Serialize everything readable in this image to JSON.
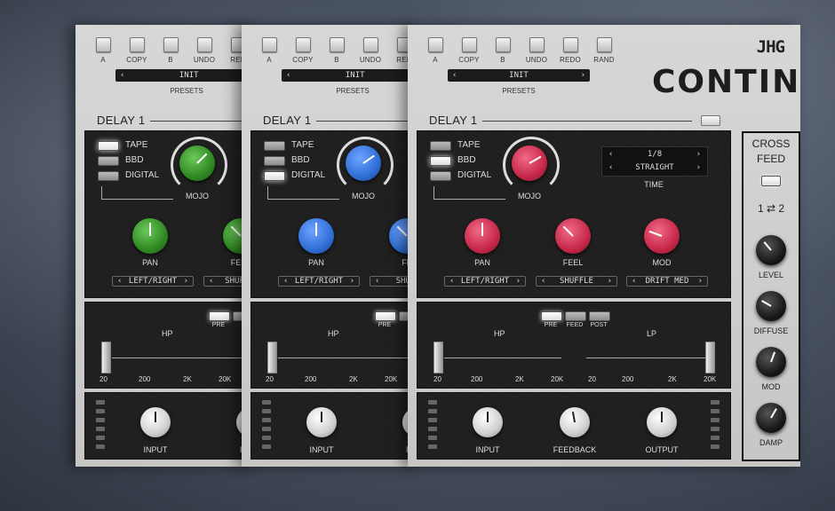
{
  "top_buttons": [
    "A",
    "COPY",
    "B",
    "UNDO",
    "REDO",
    "RAND"
  ],
  "top_buttons_clipped": "REDO",
  "top_buttons_clipped_short": "RED",
  "preset": {
    "value": "INIT",
    "label": "PRESETS",
    "prev": "‹",
    "next": "›"
  },
  "delay_title": "DELAY 1",
  "types": [
    "TAPE",
    "BBD",
    "DIGITAL"
  ],
  "brand": "CONTIN",
  "logo": "JHG",
  "labels": {
    "mojo": "MOJO",
    "pan": "PAN",
    "feel": "FEEL",
    "mod": "MOD",
    "time": "TIME",
    "input": "INPUT",
    "feedback": "FEEDBACK",
    "output": "OUTPUT",
    "hp": "HP",
    "lp": "LP",
    "pre": "PRE",
    "feed": "FEED",
    "post": "POST",
    "feel_clipped": "FE",
    "feed_clipped": "FEED"
  },
  "selectors": {
    "pan": "LEFT/RIGHT",
    "feel": "SHUFFLE",
    "feel_clipped": "SHUFF",
    "feel_clipped2": "SHU",
    "mod": "DRIFT MED"
  },
  "time": {
    "value": "1/8",
    "mode": "STRAIGHT"
  },
  "scale": [
    "20",
    "200",
    "2K",
    "20K"
  ],
  "crossfeed": {
    "title_line1": "CROSS",
    "title_line2": "FEED",
    "routing": "1 ⇄ 2",
    "knobs": [
      "LEVEL",
      "DIFFUSE",
      "MOD",
      "DAMP"
    ]
  },
  "colors": {
    "green": "#3a9a2c",
    "blue": "#2f6fd6",
    "red": "#c8284a",
    "panel": "#1e1e1e"
  },
  "instances": [
    {
      "accent": "green",
      "type_selected": "TAPE"
    },
    {
      "accent": "blue",
      "type_selected": "DIGITAL"
    },
    {
      "accent": "red",
      "type_selected": "BBD"
    }
  ]
}
